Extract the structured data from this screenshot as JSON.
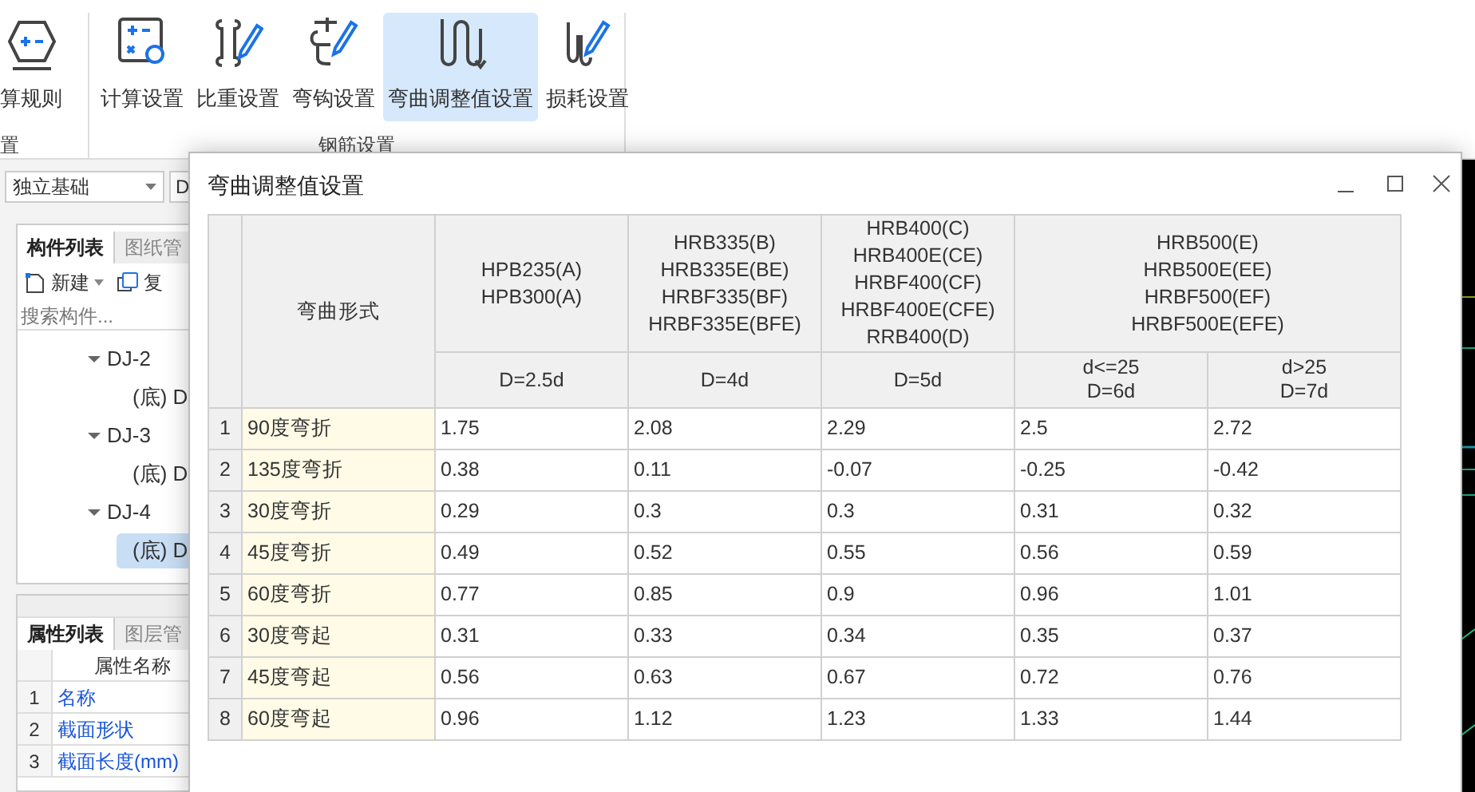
{
  "ribbon": {
    "groups": [
      {
        "label": "置",
        "buttons": [
          {
            "label": "算规则",
            "kind": "rule",
            "selected": false
          }
        ]
      },
      {
        "label": "钢筋设置",
        "buttons": [
          {
            "label": "计算设置",
            "kind": "calc",
            "selected": false
          },
          {
            "label": "比重设置",
            "kind": "weight",
            "selected": false
          },
          {
            "label": "弯钩设置",
            "kind": "hook",
            "selected": false
          },
          {
            "label": "弯曲调整值设置",
            "kind": "bend",
            "selected": true
          },
          {
            "label": "损耗设置",
            "kind": "loss",
            "selected": false
          }
        ]
      }
    ]
  },
  "left_panel": {
    "type_dropdown": "独立基础",
    "floor_dropdown": "D",
    "component_tabs": [
      {
        "label": "构件列表",
        "selected": true
      },
      {
        "label": "图纸管",
        "selected": false
      }
    ],
    "toolbar": [
      {
        "label": "新建",
        "kind": "new"
      },
      {
        "label": "复",
        "kind": "copy"
      }
    ],
    "search": {
      "placeholder": "搜索构件..."
    },
    "tree": [
      {
        "label": "DJ-2",
        "expanded": true,
        "children": [
          {
            "label": "(底) D",
            "selected": false
          }
        ]
      },
      {
        "label": "DJ-3",
        "expanded": true,
        "children": [
          {
            "label": "(底) D",
            "selected": false
          }
        ]
      },
      {
        "label": "DJ-4",
        "expanded": true,
        "children": [
          {
            "label": "(底) D",
            "selected": true
          }
        ]
      }
    ],
    "property_tabs": [
      {
        "label": "属性列表",
        "selected": true
      },
      {
        "label": "图层管",
        "selected": false
      }
    ],
    "property_table": {
      "header": "属性名称",
      "rows": [
        {
          "index": "1",
          "name": "名称"
        },
        {
          "index": "2",
          "name": "截面形状"
        },
        {
          "index": "3",
          "name": "截面长度(mm)"
        }
      ]
    }
  },
  "dialog": {
    "title": "弯曲调整值设置",
    "table": {
      "corner_header": "弯曲形式",
      "groups": [
        {
          "grades": [
            "HPB235(A)",
            "HPB300(A)"
          ],
          "columns": [
            [
              "D=2.5d"
            ]
          ]
        },
        {
          "grades": [
            "HRB335(B)",
            "HRB335E(BE)",
            "HRBF335(BF)",
            "HRBF335E(BFE)"
          ],
          "columns": [
            [
              "D=4d"
            ]
          ]
        },
        {
          "grades": [
            "HRB400(C)",
            "HRB400E(CE)",
            "HRBF400(CF)",
            "HRBF400E(CFE)",
            "RRB400(D)"
          ],
          "columns": [
            [
              "D=5d"
            ]
          ]
        },
        {
          "grades": [
            "HRB500(E)",
            "HRB500E(EE)",
            "HRBF500(EF)",
            "HRBF500E(EFE)"
          ],
          "columns": [
            [
              "d<=25",
              "D=6d"
            ],
            [
              "d>25",
              "D=7d"
            ]
          ]
        }
      ],
      "rows": [
        {
          "index": "1",
          "form": "90度弯折",
          "values": [
            "1.75",
            "2.08",
            "2.29",
            "2.5",
            "2.72"
          ]
        },
        {
          "index": "2",
          "form": "135度弯折",
          "values": [
            "0.38",
            "0.11",
            "-0.07",
            "-0.25",
            "-0.42"
          ]
        },
        {
          "index": "3",
          "form": "30度弯折",
          "values": [
            "0.29",
            "0.3",
            "0.3",
            "0.31",
            "0.32"
          ]
        },
        {
          "index": "4",
          "form": "45度弯折",
          "values": [
            "0.49",
            "0.52",
            "0.55",
            "0.56",
            "0.59"
          ]
        },
        {
          "index": "5",
          "form": "60度弯折",
          "values": [
            "0.77",
            "0.85",
            "0.9",
            "0.96",
            "1.01"
          ]
        },
        {
          "index": "6",
          "form": "30度弯起",
          "values": [
            "0.31",
            "0.33",
            "0.34",
            "0.35",
            "0.37"
          ]
        },
        {
          "index": "7",
          "form": "45度弯起",
          "values": [
            "0.56",
            "0.63",
            "0.67",
            "0.72",
            "0.76"
          ]
        },
        {
          "index": "8",
          "form": "60度弯起",
          "values": [
            "0.96",
            "1.12",
            "1.23",
            "1.33",
            "1.44"
          ]
        }
      ]
    }
  }
}
